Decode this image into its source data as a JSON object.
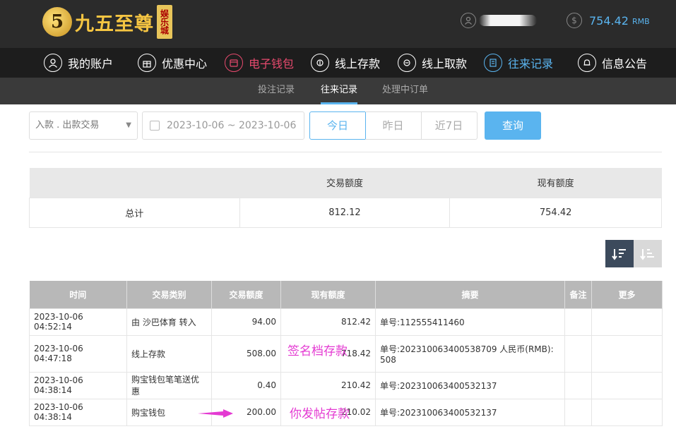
{
  "header": {
    "logo_text": "九五至尊",
    "logo_tag": "娱乐城",
    "logo_badge": "5",
    "balance": "754.42",
    "balance_unit": "RMB",
    "dollar_icon": "$"
  },
  "nav": {
    "items": [
      {
        "label": "我的账户",
        "icon": "user-icon"
      },
      {
        "label": "优惠中心",
        "icon": "gift-icon"
      },
      {
        "label": "电子钱包",
        "icon": "wallet-icon"
      },
      {
        "label": "线上存款",
        "icon": "deposit-icon"
      },
      {
        "label": "线上取款",
        "icon": "withdraw-icon"
      },
      {
        "label": "往来记录",
        "icon": "records-icon"
      },
      {
        "label": "信息公告",
        "icon": "bell-icon"
      }
    ]
  },
  "subnav": {
    "items": [
      "投注记录",
      "往来记录",
      "处理中订单"
    ],
    "active": "往来记录"
  },
  "filter": {
    "type_select": "入款 . 出款交易",
    "date_range": "2023-10-06 ~ 2023-10-06",
    "today": "今日",
    "yesterday": "昨日",
    "last7": "近7日",
    "query": "查询"
  },
  "summary": {
    "col_amount": "交易额度",
    "col_balance": "现有额度",
    "row_label": "总计",
    "amount": "812.12",
    "balance": "754.42"
  },
  "records": {
    "headers": [
      "时间",
      "交易类别",
      "交易额度",
      "现有额度",
      "摘要",
      "备注",
      "更多"
    ],
    "rows": [
      {
        "time": "2023-10-06 04:52:14",
        "type": "由 沙巴体育 转入",
        "amount": "94.00",
        "balance": "812.42",
        "summary": "单号:112555411460"
      },
      {
        "time": "2023-10-06 04:47:18",
        "type": "线上存款",
        "amount": "508.00",
        "balance": "718.42",
        "summary": "单号:202310063400538709 人民币(RMB): 508"
      },
      {
        "time": "2023-10-06 04:38:14",
        "type": "购宝钱包笔笔送优惠",
        "amount": "0.40",
        "balance": "210.42",
        "summary": "单号:202310063400532137"
      },
      {
        "time": "2023-10-06 04:38:14",
        "type": "购宝钱包",
        "amount": "200.00",
        "balance": "210.02",
        "summary": "单号:202310063400532137"
      }
    ]
  },
  "overlays": {
    "text1": "签名档存款",
    "text2": "你发帖存款"
  },
  "colors": {
    "accent": "#5ab4ef",
    "wallet": "#e84a6e",
    "overlay": "#e43ad2"
  }
}
